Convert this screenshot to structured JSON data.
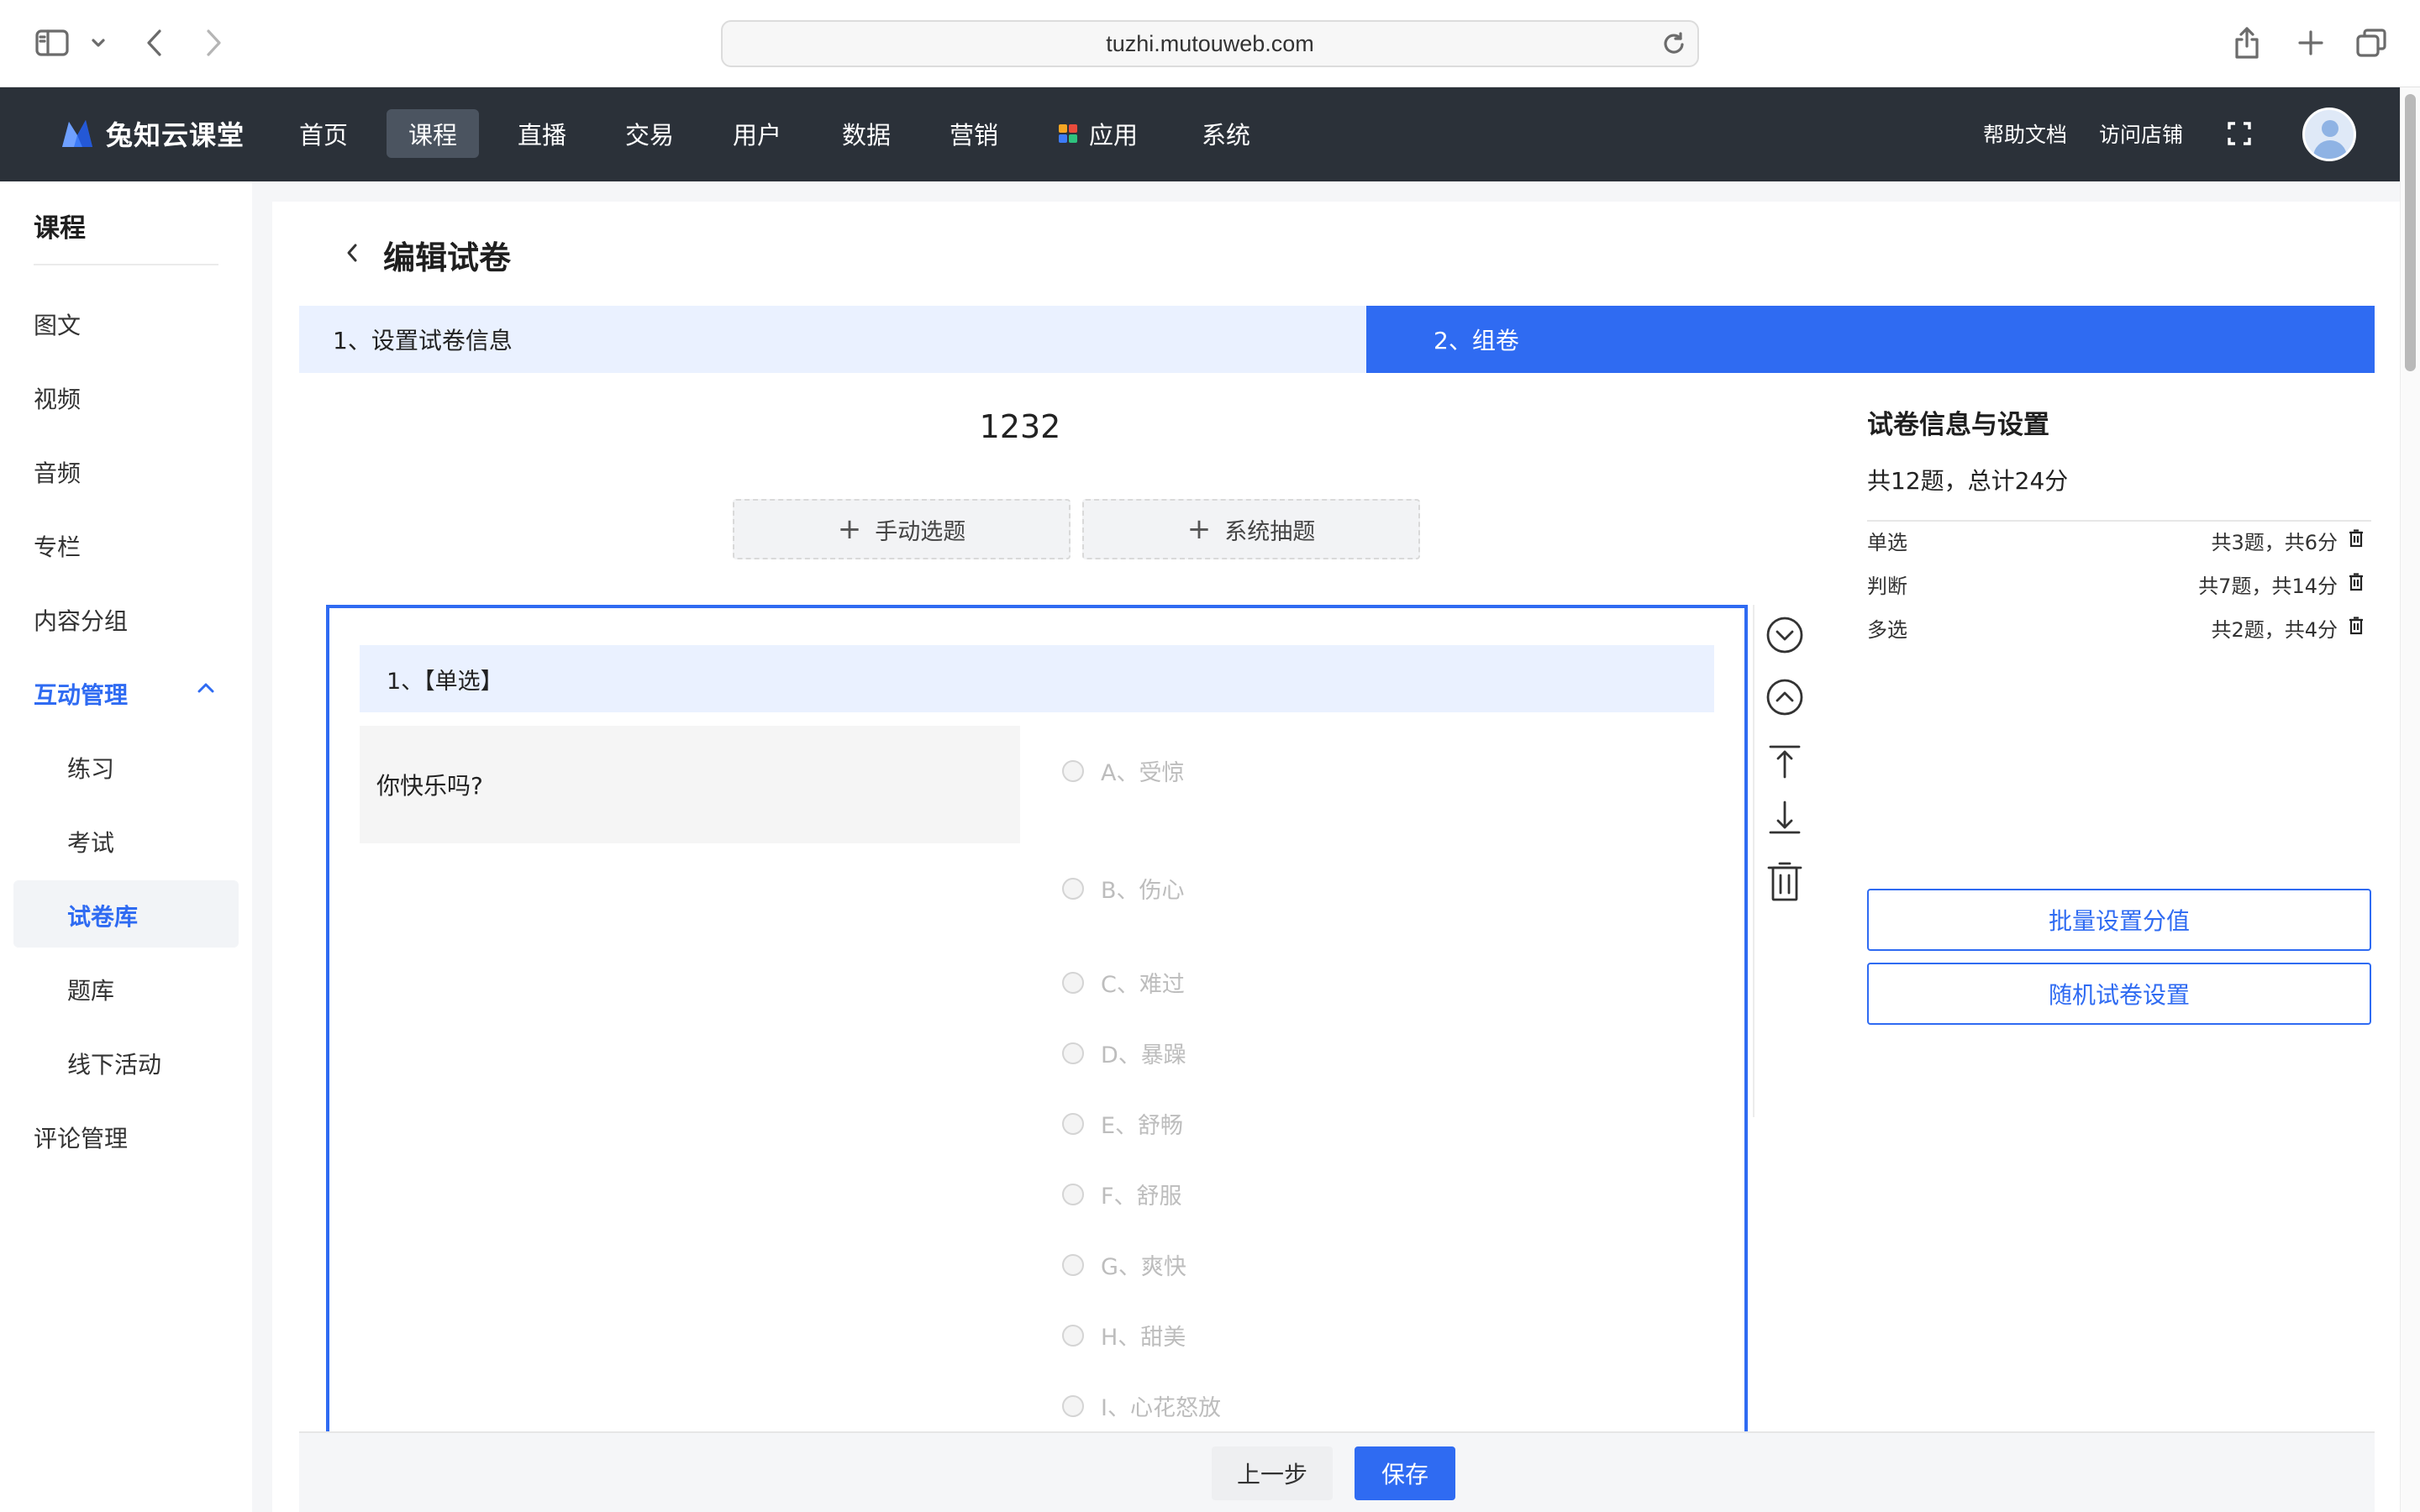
{
  "browser": {
    "url": "tuzhi.mutouweb.com"
  },
  "topnav": {
    "logo_text": "兔知云课堂",
    "items": [
      {
        "label": "首页"
      },
      {
        "label": "课程"
      },
      {
        "label": "直播"
      },
      {
        "label": "交易"
      },
      {
        "label": "用户"
      },
      {
        "label": "数据"
      },
      {
        "label": "营销"
      },
      {
        "label": "应用"
      },
      {
        "label": "系统"
      }
    ],
    "active_item": "课程",
    "help_docs": "帮助文档",
    "visit_store": "访问店铺"
  },
  "sidebar": {
    "title": "课程",
    "items": [
      {
        "label": "图文"
      },
      {
        "label": "视频"
      },
      {
        "label": "音频"
      },
      {
        "label": "专栏"
      },
      {
        "label": "内容分组"
      },
      {
        "label": "互动管理"
      },
      {
        "label": "练习"
      },
      {
        "label": "考试"
      },
      {
        "label": "试卷库"
      },
      {
        "label": "题库"
      },
      {
        "label": "线下活动"
      },
      {
        "label": "评论管理"
      }
    ],
    "expanded_group": "互动管理",
    "active_item": "试卷库"
  },
  "page": {
    "title": "编辑试卷",
    "steps": [
      {
        "label": "1、设置试卷信息"
      },
      {
        "label": "2、组卷"
      }
    ],
    "active_step": "2、组卷",
    "paper_name": "1232",
    "manual_select": "手动选题",
    "system_draw": "系统抽题"
  },
  "question": {
    "header": "1、【单选】",
    "stem": "你快乐吗?",
    "options": [
      {
        "label": "A、受惊"
      },
      {
        "label": "B、伤心"
      },
      {
        "label": "C、难过"
      },
      {
        "label": "D、暴躁"
      },
      {
        "label": "E、舒畅"
      },
      {
        "label": "F、舒服"
      },
      {
        "label": "G、爽快"
      },
      {
        "label": "H、甜美"
      },
      {
        "label": "I、心花怒放"
      }
    ]
  },
  "info": {
    "title": "试卷信息与设置",
    "summary": "共12题，总计24分",
    "types": [
      {
        "label": "单选",
        "count": "共3题，共6分"
      },
      {
        "label": "判断",
        "count": "共7题，共14分"
      },
      {
        "label": "多选",
        "count": "共2题，共4分"
      }
    ],
    "batch_score": "批量设置分值",
    "random_settings": "随机试卷设置"
  },
  "footer": {
    "prev": "上一步",
    "save": "保存"
  },
  "colors": {
    "accent": "#2f6bf2",
    "nav_bg": "#2b3139",
    "step_light": "#eaf1ff"
  }
}
